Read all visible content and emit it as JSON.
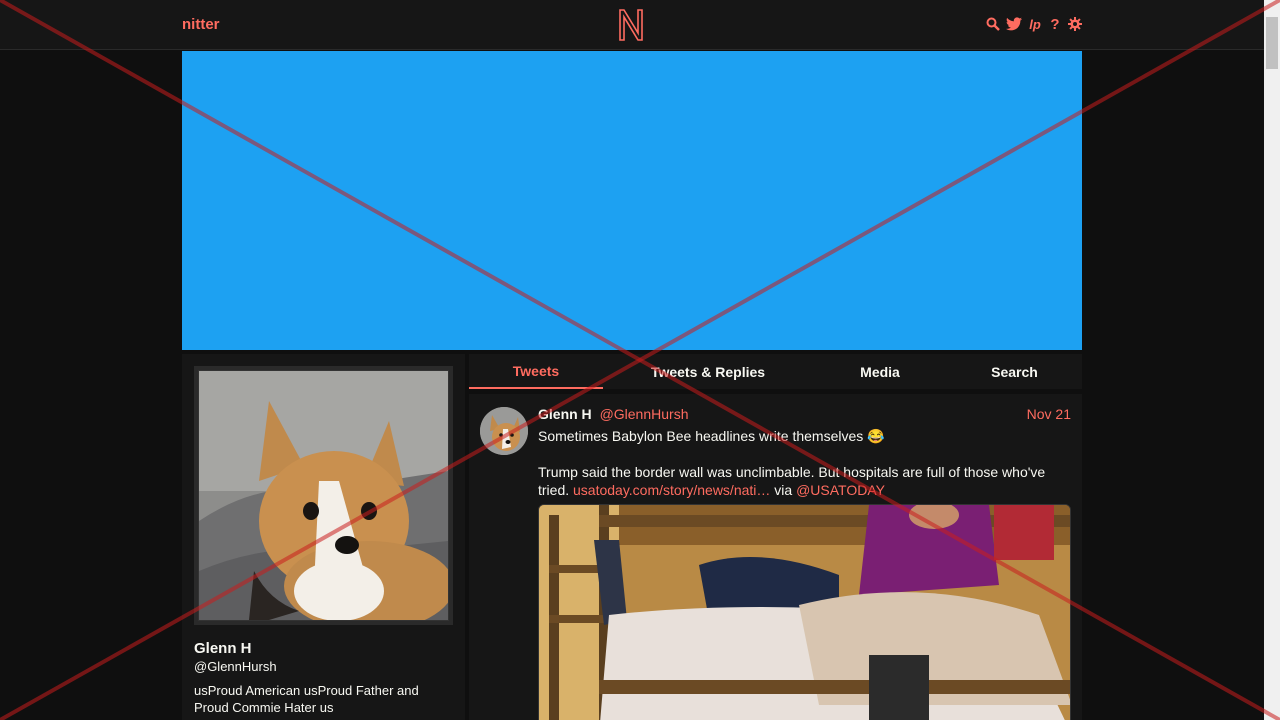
{
  "navbar": {
    "brand": "nitter",
    "logo_letter": "N",
    "icons": [
      "search-icon",
      "twitter-bird-icon",
      "lp-icon",
      "help-icon",
      "settings-icon"
    ],
    "help_glyph": "?",
    "lp_glyph": "lp"
  },
  "profile": {
    "fullname": "Glenn H",
    "username": "@GlennHursh",
    "bio": "usProud American usProud Father and Proud Commie Hater us"
  },
  "tabs": [
    {
      "label": "Tweets",
      "active": true
    },
    {
      "label": "Tweets & Replies",
      "active": false
    },
    {
      "label": "Media",
      "active": false
    },
    {
      "label": "Search",
      "active": false
    }
  ],
  "tweet": {
    "fullname": "Glenn H",
    "username": "@GlennHursh",
    "date": "Nov 21",
    "line1": "Sometimes Babylon Bee headlines write themselves 😂",
    "line2": "Trump said the border wall was unclimbable. But hospitals are full of those who've tried.",
    "link": "usatoday.com/story/news/nati…",
    "via": "via",
    "mention": "@USATODAY"
  },
  "colors": {
    "accent": "#ff6c60",
    "banner": "#1da1f2",
    "background": "#0f0f0f",
    "panel": "#161616",
    "text": "#f8f8f2"
  }
}
